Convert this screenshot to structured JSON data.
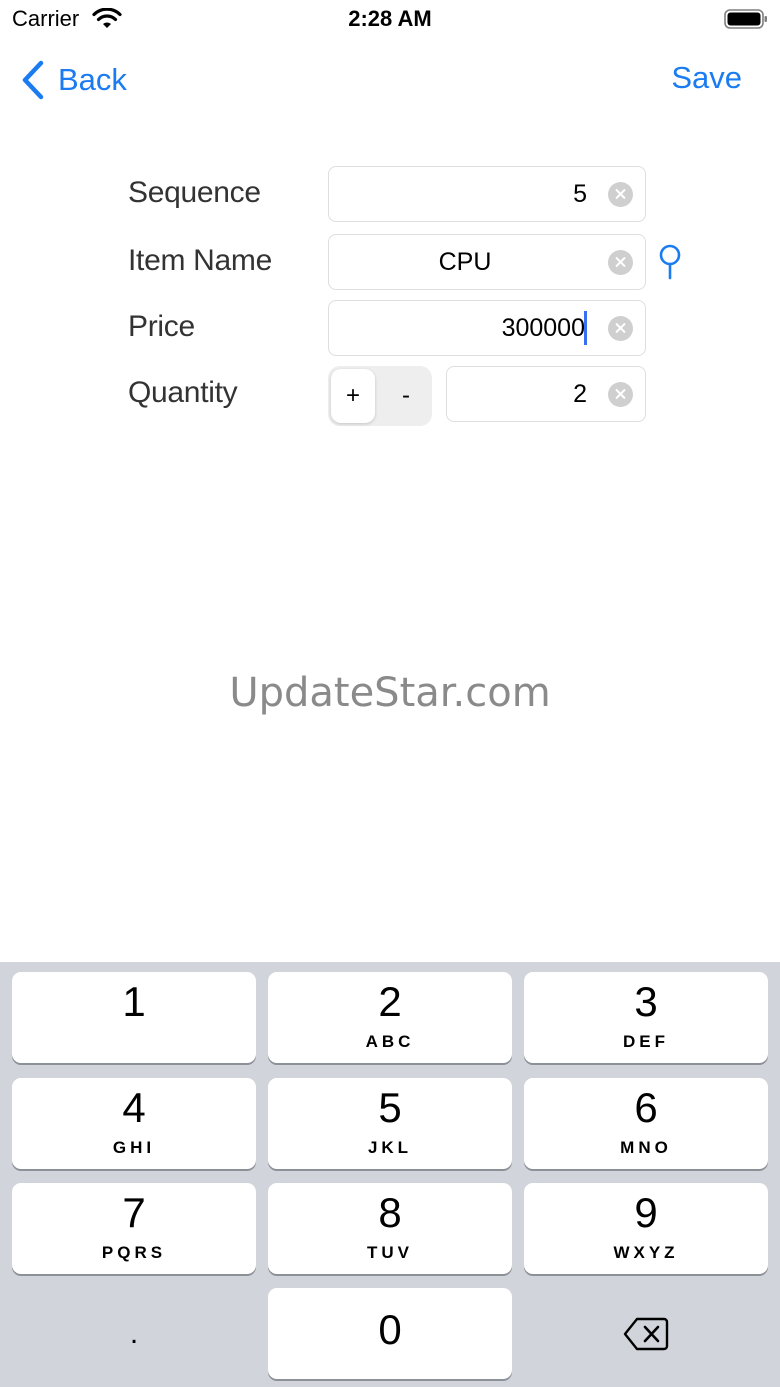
{
  "status_bar": {
    "carrier": "Carrier",
    "time": "2:28 AM"
  },
  "nav": {
    "back_label": "Back",
    "save_label": "Save",
    "accent_color": "#1a7cf0"
  },
  "form": {
    "sequence": {
      "label": "Sequence",
      "value": "5"
    },
    "item_name": {
      "label": "Item Name",
      "value": "CPU"
    },
    "price": {
      "label": "Price",
      "value": "300000"
    },
    "quantity": {
      "label": "Quantity",
      "value": "2",
      "plus": "+",
      "minus": "-"
    }
  },
  "watermark": "UpdateStar.com",
  "keyboard": {
    "keys": [
      {
        "num": "1",
        "letters": ""
      },
      {
        "num": "2",
        "letters": "ABC"
      },
      {
        "num": "3",
        "letters": "DEF"
      },
      {
        "num": "4",
        "letters": "GHI"
      },
      {
        "num": "5",
        "letters": "JKL"
      },
      {
        "num": "6",
        "letters": "MNO"
      },
      {
        "num": "7",
        "letters": "PQRS"
      },
      {
        "num": "8",
        "letters": "TUV"
      },
      {
        "num": "9",
        "letters": "WXYZ"
      },
      {
        "num": "0",
        "letters": ""
      }
    ],
    "dot": "."
  }
}
